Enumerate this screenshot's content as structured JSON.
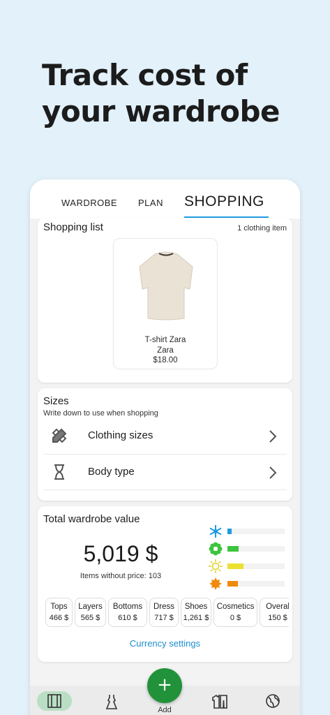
{
  "headline": {
    "line1": "Track cost of",
    "line2": "your wardrobe"
  },
  "tabs": [
    {
      "label": "WARDROBE",
      "active": false
    },
    {
      "label": "PLAN",
      "active": false
    },
    {
      "label": "SHOPPING",
      "active": true
    }
  ],
  "shopping_list": {
    "title": "Shopping list",
    "count": "1 clothing item",
    "items": [
      {
        "name": "T-shirt Zara",
        "brand": "Zara",
        "price": "$18.00"
      }
    ]
  },
  "sizes": {
    "title": "Sizes",
    "subtitle": "Write down to use when shopping",
    "rows": [
      {
        "label": "Clothing sizes",
        "icon": "ruler-pencil-icon"
      },
      {
        "label": "Body type",
        "icon": "hourglass-icon"
      }
    ]
  },
  "wardrobe_value": {
    "title": "Total wardrobe value",
    "value": "5,019 $",
    "no_price": "Items without price: 103",
    "seasons": [
      {
        "name": "winter",
        "icon": "snowflake-icon",
        "color": "#1e9be0",
        "level": 0.07
      },
      {
        "name": "spring",
        "icon": "flower-icon",
        "color": "#3ec43e",
        "level": 0.2
      },
      {
        "name": "summer",
        "icon": "sun-icon",
        "color": "#ece032",
        "level": 0.28
      },
      {
        "name": "autumn",
        "icon": "leaf-icon",
        "color": "#f08a0c",
        "level": 0.18
      }
    ],
    "categories": [
      {
        "label": "Tops",
        "value": "466 $"
      },
      {
        "label": "Layers",
        "value": "565 $"
      },
      {
        "label": "Bottoms",
        "value": "610 $"
      },
      {
        "label": "Dress",
        "value": "717 $"
      },
      {
        "label": "Shoes",
        "value": "1,261 $"
      },
      {
        "label": "Cosmetics",
        "value": "0 $"
      },
      {
        "label": "Overal",
        "value": "150 $"
      }
    ],
    "currency_link": "Currency settings"
  },
  "bottom_nav": {
    "add_label": "Add",
    "fab_symbol": "+",
    "items": [
      "wardrobe-icon",
      "dress-icon",
      "outfit-icon",
      "globe-icon"
    ]
  },
  "colors": {
    "accent": "#1e9be0",
    "fab": "#21923a",
    "nav_active": "#b9dec4"
  }
}
